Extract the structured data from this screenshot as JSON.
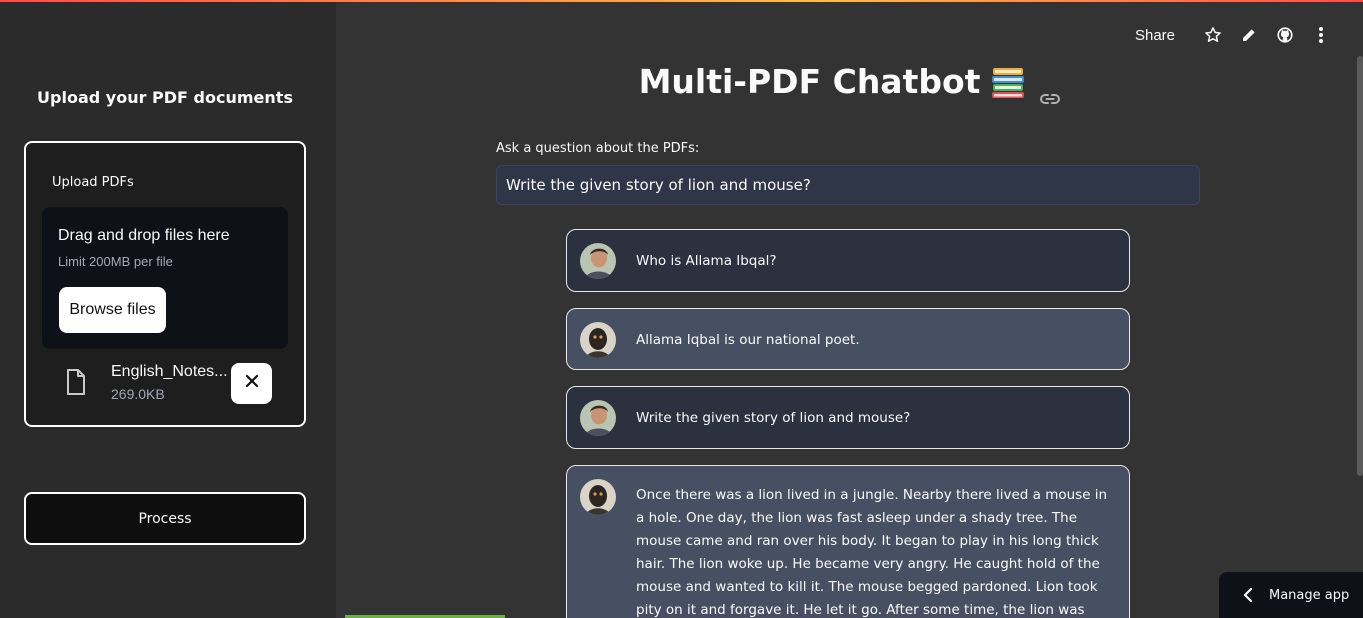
{
  "sidebar": {
    "title": "Upload your PDF documents",
    "uploader": {
      "label": "Upload PDFs",
      "drop_text": "Drag and drop files here",
      "limit_text": "Limit 200MB per file",
      "browse_label": "Browse files",
      "file_name": "English_Notes...",
      "file_size": "269.0KB"
    },
    "process_label": "Process"
  },
  "toolbar": {
    "share_label": "Share",
    "icons": [
      "star-icon",
      "pencil-icon",
      "github-icon",
      "more-vert-icon"
    ]
  },
  "main": {
    "title": "Multi-PDF Chatbot",
    "question_label": "Ask a question about the PDFs:",
    "question_value": "Write the given story of lion and mouse?"
  },
  "chat": [
    {
      "role": "user",
      "text": "Who is Allama Ibqal?"
    },
    {
      "role": "bot",
      "text": "Allama Iqbal is our national poet."
    },
    {
      "role": "user",
      "text": "Write the given story of lion and mouse?"
    },
    {
      "role": "bot",
      "text": "Once there was a lion lived in a jungle. Nearby there lived a mouse in a hole. One day, the lion was fast asleep under a shady tree. The mouse came and ran over his body. It began to play in his long thick hair. The lion woke up. He became very angry. He caught hold of the mouse and wanted to kill it. The mouse begged pardoned. Lion took pity on it and forgave it. He let it go. After some time, the lion was caught in a trap. He struggled hard but could not free"
    }
  ],
  "manage_app_label": "Manage app",
  "colors": {
    "background": "#333333",
    "sidebar": "#2b2b2b",
    "user_bubble": "#2b313e",
    "bot_bubble": "#475063",
    "input_bg": "#2e3648"
  }
}
